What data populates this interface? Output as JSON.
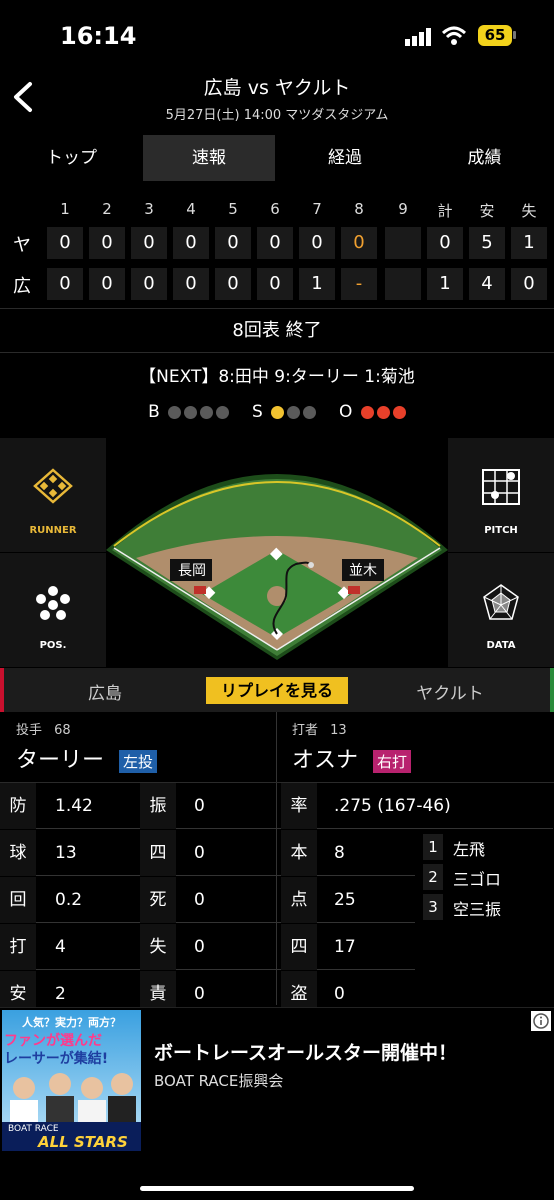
{
  "status_bar": {
    "time": "16:14",
    "battery": "65"
  },
  "header": {
    "title": "広島 vs ヤクルト",
    "subtitle": "5月27日(土) 14:00 マツダスタジアム"
  },
  "tabs": [
    {
      "label": "トップ"
    },
    {
      "label": "速報"
    },
    {
      "label": "経過"
    },
    {
      "label": "成績"
    }
  ],
  "scoreboard": {
    "headers": [
      "1",
      "2",
      "3",
      "4",
      "5",
      "6",
      "7",
      "8",
      "9",
      "計",
      "安",
      "失"
    ],
    "rows": [
      {
        "team": "ヤ",
        "innings": [
          "0",
          "0",
          "0",
          "0",
          "0",
          "0",
          "0",
          "0",
          ""
        ],
        "totals": [
          "0",
          "5",
          "1"
        ]
      },
      {
        "team": "広",
        "innings": [
          "0",
          "0",
          "0",
          "0",
          "0",
          "0",
          "1",
          "-",
          ""
        ],
        "totals": [
          "1",
          "4",
          "0"
        ]
      }
    ],
    "highlight_color": "#f0a030"
  },
  "inning_status": "8回表 終了",
  "next_batters": "【NEXT】8:田中 9:ターリー 1:菊池",
  "count": {
    "b_label": "B",
    "s_label": "S",
    "o_label": "O",
    "balls": 0,
    "strikes": 1,
    "outs": 3
  },
  "field": {
    "runner_label": "RUNNER",
    "pitch_label": "PITCH",
    "pos_label": "POS.",
    "data_label": "DATA",
    "fielder_left": "長岡",
    "fielder_right": "並木"
  },
  "team_bar": {
    "home": "広島",
    "replay": "リプレイを見る",
    "away": "ヤクルト"
  },
  "pitcher": {
    "role": "投手",
    "number": "68",
    "name": "ターリー",
    "hand": "左投"
  },
  "batter": {
    "role": "打者",
    "number": "13",
    "name": "オスナ",
    "hand": "右打"
  },
  "pitcher_stats": [
    {
      "k1": "防",
      "v1": "1.42",
      "k2": "振",
      "v2": "0"
    },
    {
      "k1": "球",
      "v1": "13",
      "k2": "四",
      "v2": "0"
    },
    {
      "k1": "回",
      "v1": "0.2",
      "k2": "死",
      "v2": "0"
    },
    {
      "k1": "打",
      "v1": "4",
      "k2": "失",
      "v2": "0"
    },
    {
      "k1": "安",
      "v1": "2",
      "k2": "責",
      "v2": "0"
    }
  ],
  "batter_stats": [
    {
      "k": "率",
      "v": ".275 (167-46)"
    },
    {
      "k": "本",
      "v": "8"
    },
    {
      "k": "点",
      "v": "25"
    },
    {
      "k": "四",
      "v": "17"
    },
    {
      "k": "盗",
      "v": "0"
    }
  ],
  "at_bats": [
    {
      "n": "1",
      "r": "左飛"
    },
    {
      "n": "2",
      "r": "三ゴロ"
    },
    {
      "n": "3",
      "r": "空三振"
    }
  ],
  "ad": {
    "title": "ボートレースオールスター開催中！",
    "sponsor": "BOAT RACE振興会",
    "img_top": "人気？実力？両方？",
    "img_mid": "ファンが選んだ",
    "img_mid2": "レーサーが集結!",
    "img_brand": "BOAT RACE",
    "img_allstars": "ALL STARS"
  }
}
